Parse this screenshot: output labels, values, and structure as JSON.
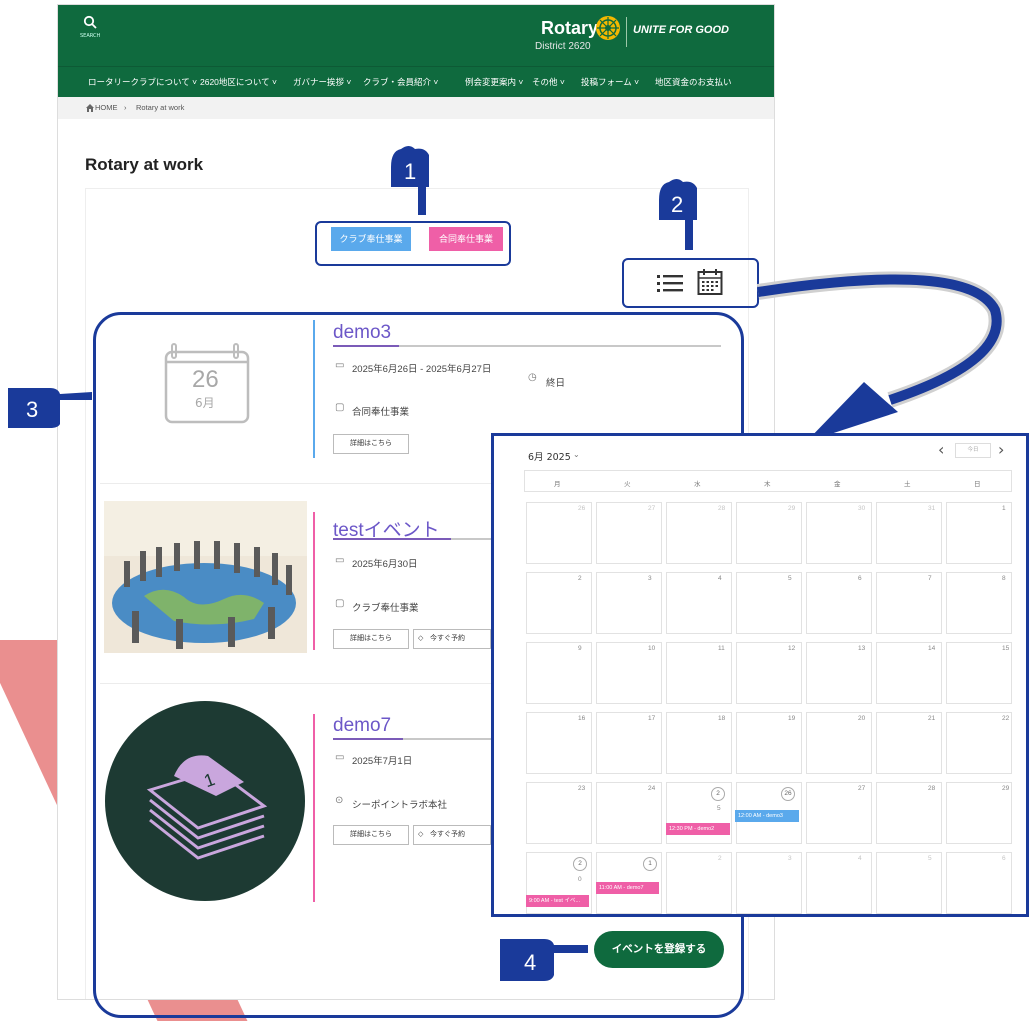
{
  "header": {
    "search_label": "SEARCH",
    "logo_name": "Rotary",
    "logo_district": "District 2620",
    "slogan": "UNITE FOR GOOD"
  },
  "nav": {
    "items": [
      "ロータリークラブについて ˅",
      "2620地区について ˅",
      "ガバナー挨拶 ˅",
      "クラブ・会員紹介 ˅",
      "例会変更案内 ˅",
      "その他 ˅",
      "投稿フォーム ˅",
      "地区資金のお支払い"
    ]
  },
  "breadcrumb": {
    "home": "HOME",
    "separator": "›",
    "current": "Rotary at work"
  },
  "page_title": "Rotary at work",
  "categories": [
    {
      "label": "クラブ奉仕事業",
      "color": "#5aa9ec"
    },
    {
      "label": "合同奉仕事業",
      "color": "#ef5fa7"
    }
  ],
  "callouts": [
    "1",
    "2",
    "3",
    "4"
  ],
  "events": [
    {
      "title": "demo3",
      "date": "2025年6月26日 - 2025年6月27日",
      "allday": "終日",
      "category": "合同奉仕事業",
      "thumb_day": "26",
      "thumb_month": "6月",
      "details_btn": "詳細はこちら",
      "accent": "#5aa9ec"
    },
    {
      "title": "testイベント",
      "date": "2025年6月30日",
      "category": "クラブ奉仕事業",
      "details_btn": "詳細はこちら",
      "reserve_btn": "今すぐ予約",
      "accent": "#ef5fa7"
    },
    {
      "title": "demo7",
      "date": "2025年7月1日",
      "location": "シーポイントラボ本社",
      "details_btn": "詳細はこちら",
      "reserve_btn": "今すぐ予約",
      "accent": "#ef5fa7"
    }
  ],
  "calendar": {
    "month_label": "6月 2025",
    "today_btn": "今日",
    "weekdays": [
      "月",
      "火",
      "水",
      "木",
      "金",
      "土",
      "日"
    ],
    "rows": [
      [
        "26",
        "27",
        "28",
        "29",
        "30",
        "31",
        "1"
      ],
      [
        "2",
        "3",
        "4",
        "5",
        "6",
        "7",
        "8"
      ],
      [
        "9",
        "10",
        "11",
        "12",
        "13",
        "14",
        "15"
      ],
      [
        "16",
        "17",
        "18",
        "19",
        "20",
        "21",
        "22"
      ],
      [
        "23",
        "24",
        "2",
        "26",
        "27",
        "28",
        "29"
      ],
      [
        "2",
        "1",
        "2",
        "3",
        "4",
        "5",
        "6"
      ]
    ],
    "cell_counts": {
      "r4c2": "5",
      "r5c0": "0"
    },
    "events": [
      {
        "label": "12:30 PM - demo2",
        "color": "#ef5fa7"
      },
      {
        "label": "12:00 AM - demo3",
        "color": "#5aa9ec"
      },
      {
        "label": "9:00 AM - test イベ...",
        "color": "#ef5fa7"
      },
      {
        "label": "11:00 AM - demo7",
        "color": "#ef5fa7"
      }
    ]
  },
  "register_btn": "イベントを登録する",
  "colors": {
    "brand_green": "#0f6a3e",
    "callout_blue": "#1a3a9a",
    "blue": "#5aa9ec",
    "pink": "#ef5fa7"
  }
}
